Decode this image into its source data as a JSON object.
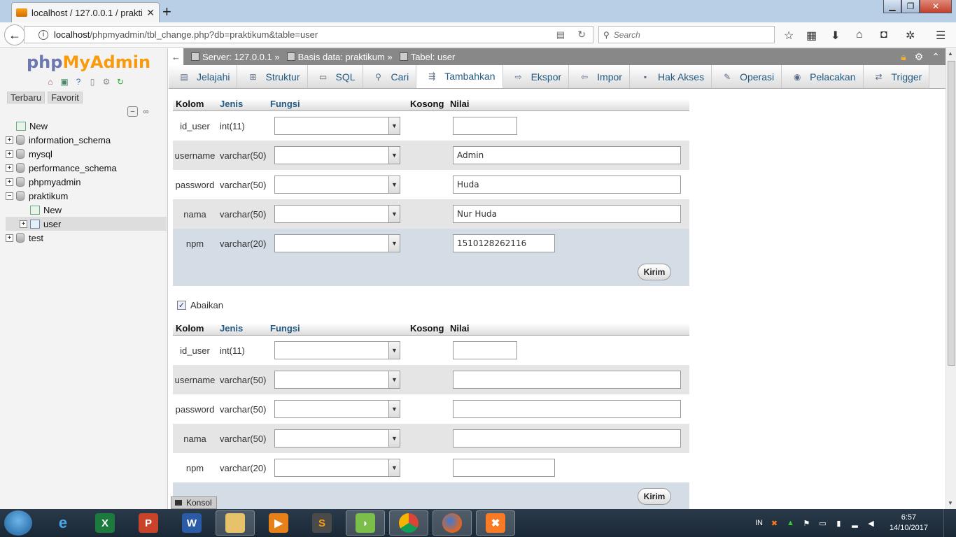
{
  "browser": {
    "tab_title": "localhost / 127.0.0.1 / praktik",
    "url_host": "localhost",
    "url_path": "/phpmyadmin/tbl_change.php?db=praktikum&table=user",
    "search_placeholder": "Search"
  },
  "logo": {
    "php": "php",
    "my": "My",
    "admin": "Admin"
  },
  "left": {
    "recent_label": "Terbaru",
    "favorite_label": "Favorit",
    "tree": [
      {
        "label": "New",
        "kind": "new",
        "level": 0
      },
      {
        "label": "information_schema",
        "kind": "db",
        "level": 0
      },
      {
        "label": "mysql",
        "kind": "db",
        "level": 0
      },
      {
        "label": "performance_schema",
        "kind": "db",
        "level": 0
      },
      {
        "label": "phpmyadmin",
        "kind": "db",
        "level": 0
      },
      {
        "label": "praktikum",
        "kind": "db",
        "level": 0
      },
      {
        "label": "New",
        "kind": "new",
        "level": 1
      },
      {
        "label": "user",
        "kind": "table",
        "level": 1
      },
      {
        "label": "test",
        "kind": "db",
        "level": 0
      }
    ]
  },
  "breadcrumb": {
    "server": "Server: 127.0.0.1 »",
    "database": "Basis data: praktikum »",
    "table": "Tabel: user"
  },
  "menu": [
    {
      "label": "Jelajahi",
      "icon": "browse-icon"
    },
    {
      "label": "Struktur",
      "icon": "structure-icon"
    },
    {
      "label": "SQL",
      "icon": "sql-icon"
    },
    {
      "label": "Cari",
      "icon": "search-icon"
    },
    {
      "label": "Tambahkan",
      "icon": "insert-icon",
      "active": true
    },
    {
      "label": "Ekspor",
      "icon": "export-icon"
    },
    {
      "label": "Impor",
      "icon": "import-icon"
    },
    {
      "label": "Hak Akses",
      "icon": "privileges-icon"
    },
    {
      "label": "Operasi",
      "icon": "operations-icon"
    },
    {
      "label": "Pelacakan",
      "icon": "tracking-icon"
    },
    {
      "label": "Trigger",
      "icon": "trigger-icon"
    }
  ],
  "form": {
    "headers": {
      "kolom": "Kolom",
      "jenis": "Jenis",
      "fungsi": "Fungsi",
      "kosong": "Kosong",
      "nilai": "Nilai"
    },
    "submit_label": "Kirim",
    "ignore_label": "Abaikan",
    "ignore_checked": true,
    "row_sets": [
      [
        {
          "column": "id_user",
          "type": "int(11)",
          "function": "",
          "value": ""
        },
        {
          "column": "username",
          "type": "varchar(50)",
          "function": "",
          "value": "Admin"
        },
        {
          "column": "password",
          "type": "varchar(50)",
          "function": "",
          "value": "Huda"
        },
        {
          "column": "nama",
          "type": "varchar(50)",
          "function": "",
          "value": "Nur Huda"
        },
        {
          "column": "npm",
          "type": "varchar(20)",
          "function": "",
          "value": "1510128262116"
        }
      ],
      [
        {
          "column": "id_user",
          "type": "int(11)",
          "function": "",
          "value": ""
        },
        {
          "column": "username",
          "type": "varchar(50)",
          "function": "",
          "value": ""
        },
        {
          "column": "password",
          "type": "varchar(50)",
          "function": "",
          "value": ""
        },
        {
          "column": "nama",
          "type": "varchar(50)",
          "function": "",
          "value": ""
        },
        {
          "column": "npm",
          "type": "varchar(20)",
          "function": "",
          "value": ""
        }
      ]
    ]
  },
  "console_label": "Konsol",
  "taskbar": {
    "lang": "IN",
    "time": "6:57",
    "date": "14/10/2017"
  }
}
